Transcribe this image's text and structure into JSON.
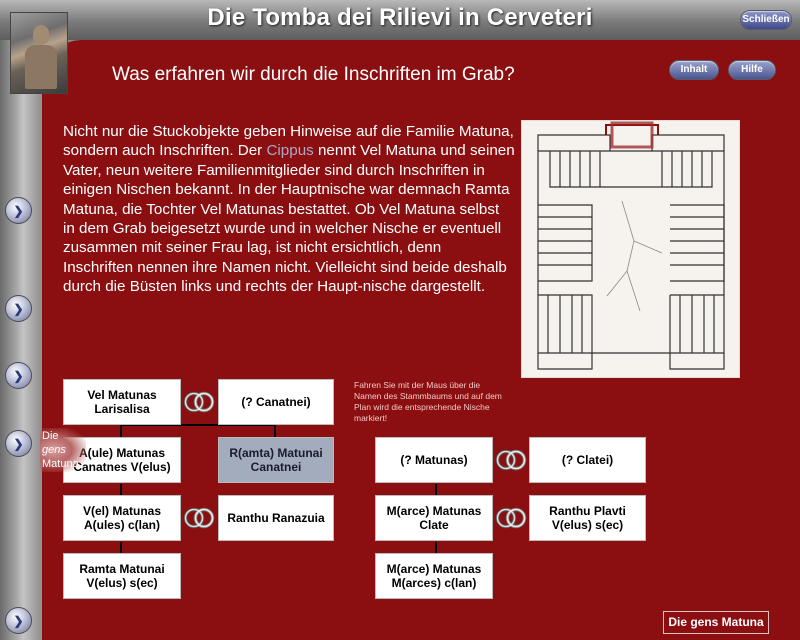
{
  "window": {
    "title": "Die Tomba dei Rilievi in Cerveteri",
    "close_label": "Schließen"
  },
  "toolbar": {
    "inhalt_label": "Inhalt",
    "hilfe_label": "Hilfe"
  },
  "page": {
    "subtitle": "Was erfahren wir durch die Inschriften im Grab?",
    "text_before_link": "Nicht nur die Stuckobjekte geben Hinweise auf die Familie Matuna, sondern auch Inschriften. Der ",
    "link_text": "Cippus",
    "text_after_link": " nennt Vel Matuna und seinen Vater, neun weitere Familienmitglieder sind durch Inschriften in einigen  Nischen bekannt. In der Hauptnische war demnach Ramta Matuna,  die Tochter Vel Matunas bestattet. Ob Vel Matuna selbst in dem Grab beigesetzt wurde und in welcher Nische er eventuell zusammen mit seiner Frau lag, ist nicht ersichtlich, denn Inschriften nennen ihre Namen nicht. Vielleicht sind beide deshalb durch die Büsten links und rechts der Haupt-nische dargestellt.",
    "hint": "Fahren Sie mit der Maus über die Namen des Stammbaums und auf dem Plan wird die entsprechende Nische markiert!"
  },
  "tree": {
    "left": {
      "vel_larisalisa": "Vel Matunas Larisalisa",
      "canatnei": "(? Canatnei)",
      "aule_matunas": "A(ule) Matunas Canatnes V(elus)",
      "ramta_canatnei": "R(amta) Matunai Canatnei",
      "vel_aules": "V(el) Matunas A(ules) c(lan)",
      "ranthu_ranazuia": "Ranthu Ranazuia",
      "ramta_velus": "Ramta Matunai V(elus) s(ec)"
    },
    "right": {
      "matunas": "(? Matunas)",
      "clatei": "(? Clatei)",
      "marce_clate": "M(arce) Matunas Clate",
      "ranthu_plavti": "Ranthu Plavti V(elus) s(ec)",
      "marce_marces": "M(arce) Matunas M(arces) c(lan)"
    }
  },
  "sidebar": {
    "gens_prefix": "Die ",
    "gens_italic": "gens",
    "gens_suffix": "Matuna"
  },
  "footer": {
    "button_label": "Die gens Matuna"
  },
  "colors": {
    "background": "#8b0f10",
    "selected_node": "#a3acbd",
    "link": "#a9a9c9"
  },
  "icons": {
    "nav": "chevron-right-icon",
    "marriage": "double-ring-icon"
  }
}
